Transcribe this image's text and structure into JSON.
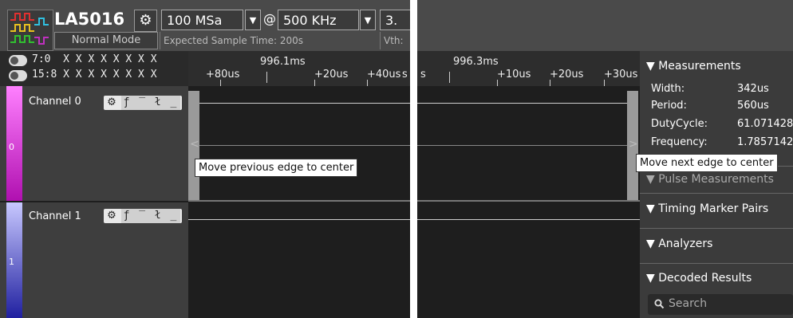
{
  "device": {
    "name": "LA5016",
    "mode": "Normal Mode"
  },
  "sample_rate": {
    "value": "100 MSa",
    "at": "@"
  },
  "sample_freq": {
    "value": "500 KHz"
  },
  "threshold": {
    "value": "3.",
    "label": "Vth:"
  },
  "expected_time": "Expected Sample Time: 200s",
  "bits": {
    "row1": "7:0  X X X X X X X X",
    "row2": "15:8 X X X X X X X X"
  },
  "ruler_left": {
    "main": "996.1ms",
    "ticks": [
      "+80us",
      "+20us",
      "+40us",
      "s"
    ]
  },
  "ruler_right": {
    "main": "996.3ms",
    "ticks": [
      "+10us",
      "+20us",
      "+30us"
    ]
  },
  "channels": [
    {
      "name": "Channel 0",
      "num": "0",
      "edges": "ƒ ‾ ł _"
    },
    {
      "name": "Channel 1",
      "num": "1",
      "edges": "ƒ ‾ ł _"
    }
  ],
  "tooltips": {
    "prev": "Move previous edge to center",
    "next": "Move next edge to center"
  },
  "arrows": {
    "prev": "<",
    "next": ">"
  },
  "measurements": {
    "title": "Measurements",
    "rows": [
      {
        "label": "Width:",
        "value": "342us"
      },
      {
        "label": "Period:",
        "value": "560us"
      },
      {
        "label": "DutyCycle:",
        "value": "61.071428"
      },
      {
        "label": "Frequency:",
        "value": "1.7857142"
      }
    ]
  },
  "sections": {
    "pulse": "Pulse Measurements",
    "timing": "Timing Marker Pairs",
    "analyzers": "Analyzers",
    "decoded": "Decoded Results"
  },
  "search": {
    "placeholder": "Search"
  },
  "colors": {
    "ch0": "#c020c8",
    "ch1": "#3030c0",
    "accent": "#2fbf2f"
  }
}
